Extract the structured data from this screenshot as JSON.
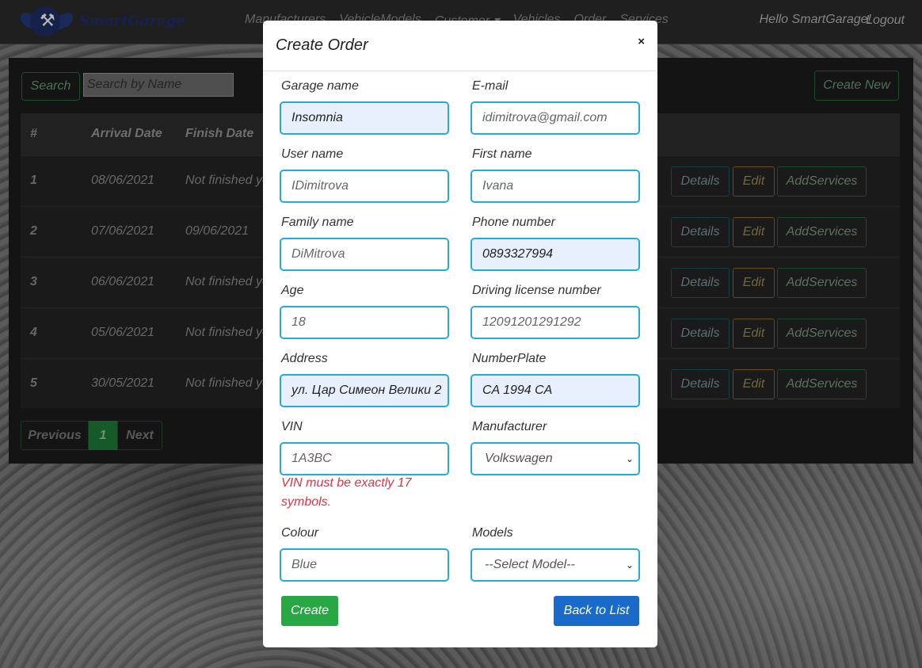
{
  "navbar": {
    "brand": "SmartGarage",
    "links": [
      "Manufacturers",
      "VehicleModels",
      "Customer ▾",
      "Vehicles",
      "Order",
      "Services"
    ],
    "greeting": "Hello SmartGarage!",
    "logout": "Logout"
  },
  "toolbar": {
    "search_label": "Search",
    "search_placeholder": "Search by Name",
    "create_new": "Create New"
  },
  "table": {
    "headers": [
      "#",
      "Arrival Date",
      "Finish Date"
    ],
    "rows": [
      {
        "num": "1",
        "arrival": "08/06/2021",
        "finish": "Not finished yet"
      },
      {
        "num": "2",
        "arrival": "07/06/2021",
        "finish": "09/06/2021"
      },
      {
        "num": "3",
        "arrival": "06/06/2021",
        "finish": "Not finished yet"
      },
      {
        "num": "4",
        "arrival": "05/06/2021",
        "finish": "Not finished yet"
      },
      {
        "num": "5",
        "arrival": "30/05/2021",
        "finish": "Not finished yet"
      }
    ],
    "actions": {
      "details": "Details",
      "edit": "Edit",
      "add_services": "AddServices"
    }
  },
  "pager": {
    "previous": "Previous",
    "page": "1",
    "next": "Next"
  },
  "modal": {
    "title": "Create Order",
    "close": "×",
    "fields": {
      "garage_name": {
        "label": "Garage name",
        "value": "Insomnia"
      },
      "email": {
        "label": "E-mail",
        "value": "idimitrova@gmail.com"
      },
      "user_name": {
        "label": "User name",
        "value": "IDimitrova"
      },
      "first_name": {
        "label": "First name",
        "value": "Ivana"
      },
      "family_name": {
        "label": "Family name",
        "value": "DiMitrova"
      },
      "phone": {
        "label": "Phone number",
        "value": "0893327994"
      },
      "age": {
        "label": "Age",
        "value": "18"
      },
      "license": {
        "label": "Driving license number",
        "value": "12091201291292"
      },
      "address": {
        "label": "Address",
        "value": "ул. Цар Симеон Велики 2"
      },
      "plate": {
        "label": "NumberPlate",
        "value": "CA 1994 CA"
      },
      "vin": {
        "label": "VIN",
        "value": "1A3BC",
        "error": "VIN must be exactly 17 symbols."
      },
      "manufacturer": {
        "label": "Manufacturer",
        "value": "Volkswagen"
      },
      "colour": {
        "label": "Colour",
        "value": "Blue"
      },
      "models": {
        "label": "Models",
        "value": "--Select Model--"
      }
    },
    "create": "Create",
    "back": "Back to List"
  }
}
